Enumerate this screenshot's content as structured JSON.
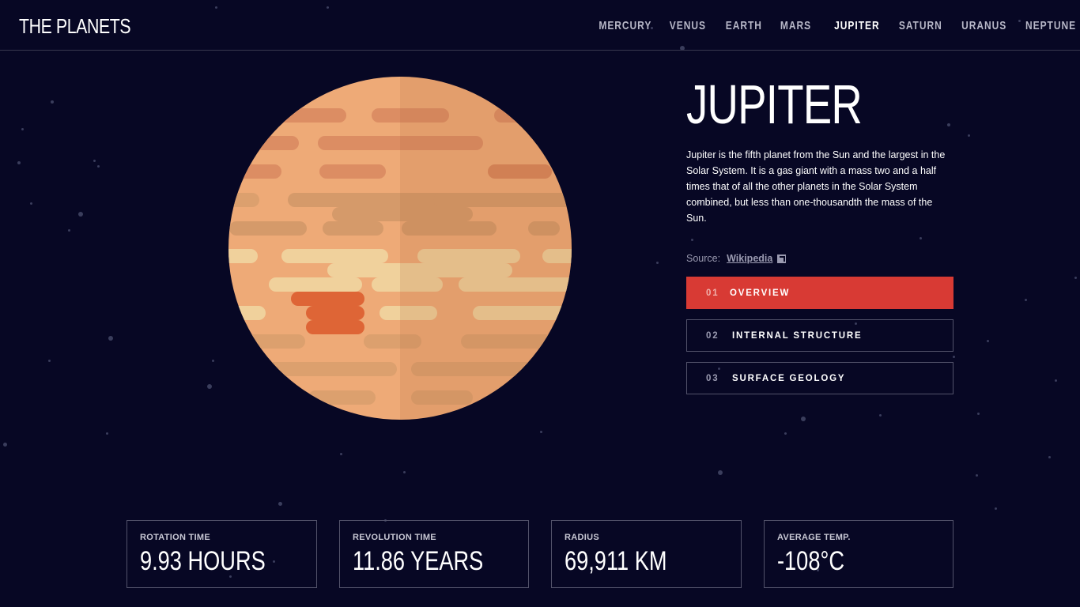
{
  "header": {
    "logo": "THE PLANETS",
    "nav": [
      {
        "label": "MERCURY",
        "active": false
      },
      {
        "label": "VENUS",
        "active": false
      },
      {
        "label": "EARTH",
        "active": false
      },
      {
        "label": "MARS",
        "active": false
      },
      {
        "label": "JUPITER",
        "active": true
      },
      {
        "label": "SATURN",
        "active": false
      },
      {
        "label": "URANUS",
        "active": false
      },
      {
        "label": "NEPTUNE",
        "active": false
      }
    ]
  },
  "planet": {
    "name": "JUPITER",
    "description": "Jupiter is the fifth planet from the Sun and the largest in the Solar System. It is a gas giant with a mass two and a half times that of all the other planets in the Solar System combined, but less than one-thousandth the mass of the Sun.",
    "source_label": "Source:",
    "source_link": "Wikipedia"
  },
  "tabs": [
    {
      "num": "01",
      "label": "OVERVIEW",
      "active": true
    },
    {
      "num": "02",
      "label": "INTERNAL STRUCTURE",
      "active": false
    },
    {
      "num": "03",
      "label": "SURFACE GEOLOGY",
      "active": false
    }
  ],
  "stats": [
    {
      "label": "ROTATION TIME",
      "value": "9.93 HOURS"
    },
    {
      "label": "REVOLUTION TIME",
      "value": "11.86 YEARS"
    },
    {
      "label": "RADIUS",
      "value": "69,911 KM"
    },
    {
      "label": "AVERAGE TEMP.",
      "value": "-108°C"
    }
  ],
  "colors": {
    "background": "#070724",
    "accent": "#d83a34",
    "border": "#38384f"
  }
}
